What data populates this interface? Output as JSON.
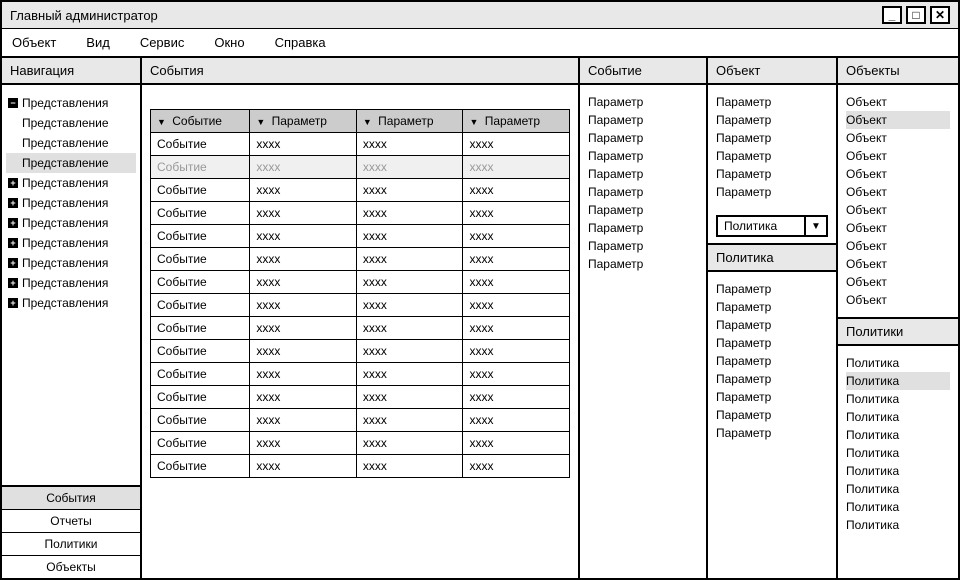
{
  "title": "Главный администратор",
  "menubar": [
    "Объект",
    "Вид",
    "Сервис",
    "Окно",
    "Справка"
  ],
  "nav": {
    "header": "Навигация",
    "tree": [
      {
        "label": "Представления",
        "icon": "minus",
        "child": false
      },
      {
        "label": "Представление",
        "icon": "",
        "child": true
      },
      {
        "label": "Представление",
        "icon": "",
        "child": true
      },
      {
        "label": "Представление",
        "icon": "",
        "child": true,
        "selected": true
      },
      {
        "label": "Представления",
        "icon": "plus",
        "child": false
      },
      {
        "label": "Представления",
        "icon": "plus",
        "child": false
      },
      {
        "label": "Представления",
        "icon": "plus",
        "child": false
      },
      {
        "label": "Представления",
        "icon": "plus",
        "child": false
      },
      {
        "label": "Представления",
        "icon": "plus",
        "child": false
      },
      {
        "label": "Представления",
        "icon": "plus",
        "child": false
      },
      {
        "label": "Представления",
        "icon": "plus",
        "child": false
      }
    ],
    "bottom": [
      {
        "label": "События",
        "active": true
      },
      {
        "label": "Отчеты",
        "active": false
      },
      {
        "label": "Политики",
        "active": false
      },
      {
        "label": "Объекты",
        "active": false
      }
    ]
  },
  "events": {
    "header": "События",
    "columns": [
      "Событие",
      "Параметр",
      "Параметр",
      "Параметр"
    ],
    "rows": [
      {
        "cells": [
          "Событие",
          "xxxx",
          "xxxx",
          "xxxx"
        ],
        "hl": false
      },
      {
        "cells": [
          "Событие",
          "xxxx",
          "xxxx",
          "xxxx"
        ],
        "hl": true
      },
      {
        "cells": [
          "Событие",
          "xxxx",
          "xxxx",
          "xxxx"
        ],
        "hl": false
      },
      {
        "cells": [
          "Событие",
          "xxxx",
          "xxxx",
          "xxxx"
        ],
        "hl": false
      },
      {
        "cells": [
          "Событие",
          "xxxx",
          "xxxx",
          "xxxx"
        ],
        "hl": false
      },
      {
        "cells": [
          "Событие",
          "xxxx",
          "xxxx",
          "xxxx"
        ],
        "hl": false
      },
      {
        "cells": [
          "Событие",
          "xxxx",
          "xxxx",
          "xxxx"
        ],
        "hl": false
      },
      {
        "cells": [
          "Событие",
          "xxxx",
          "xxxx",
          "xxxx"
        ],
        "hl": false
      },
      {
        "cells": [
          "Событие",
          "xxxx",
          "xxxx",
          "xxxx"
        ],
        "hl": false
      },
      {
        "cells": [
          "Событие",
          "xxxx",
          "xxxx",
          "xxxx"
        ],
        "hl": false
      },
      {
        "cells": [
          "Событие",
          "xxxx",
          "xxxx",
          "xxxx"
        ],
        "hl": false
      },
      {
        "cells": [
          "Событие",
          "xxxx",
          "xxxx",
          "xxxx"
        ],
        "hl": false
      },
      {
        "cells": [
          "Событие",
          "xxxx",
          "xxxx",
          "xxxx"
        ],
        "hl": false
      },
      {
        "cells": [
          "Событие",
          "xxxx",
          "xxxx",
          "xxxx"
        ],
        "hl": false
      },
      {
        "cells": [
          "Событие",
          "xxxx",
          "xxxx",
          "xxxx"
        ],
        "hl": false
      }
    ]
  },
  "event_detail": {
    "header": "Событие",
    "params": [
      "Параметр",
      "Параметр",
      "Параметр",
      "Параметр",
      "Параметр",
      "Параметр",
      "Параметр",
      "Параметр",
      "Параметр",
      "Параметр"
    ]
  },
  "object_col": {
    "header": "Объект",
    "params": [
      "Параметр",
      "Параметр",
      "Параметр",
      "Параметр",
      "Параметр",
      "Параметр"
    ],
    "select_value": "Политика",
    "policy_header": "Политика",
    "policy_params": [
      "Параметр",
      "Параметр",
      "Параметр",
      "Параметр",
      "Параметр",
      "Параметр",
      "Параметр",
      "Параметр",
      "Параметр"
    ]
  },
  "objects_col": {
    "header": "Объекты",
    "items": [
      {
        "label": "Объект",
        "sel": false
      },
      {
        "label": "Объект",
        "sel": true
      },
      {
        "label": "Объект",
        "sel": false
      },
      {
        "label": "Объект",
        "sel": false
      },
      {
        "label": "Объект",
        "sel": false
      },
      {
        "label": "Объект",
        "sel": false
      },
      {
        "label": "Объект",
        "sel": false
      },
      {
        "label": "Объект",
        "sel": false
      },
      {
        "label": "Объект",
        "sel": false
      },
      {
        "label": "Объект",
        "sel": false
      },
      {
        "label": "Объект",
        "sel": false
      },
      {
        "label": "Объект",
        "sel": false
      }
    ],
    "policies_header": "Политики",
    "policies": [
      {
        "label": "Политика",
        "sel": false
      },
      {
        "label": "Политика",
        "sel": true
      },
      {
        "label": "Политика",
        "sel": false
      },
      {
        "label": "Политика",
        "sel": false
      },
      {
        "label": "Политика",
        "sel": false
      },
      {
        "label": "Политика",
        "sel": false
      },
      {
        "label": "Политика",
        "sel": false
      },
      {
        "label": "Политика",
        "sel": false
      },
      {
        "label": "Политика",
        "sel": false
      },
      {
        "label": "Политика",
        "sel": false
      }
    ]
  }
}
